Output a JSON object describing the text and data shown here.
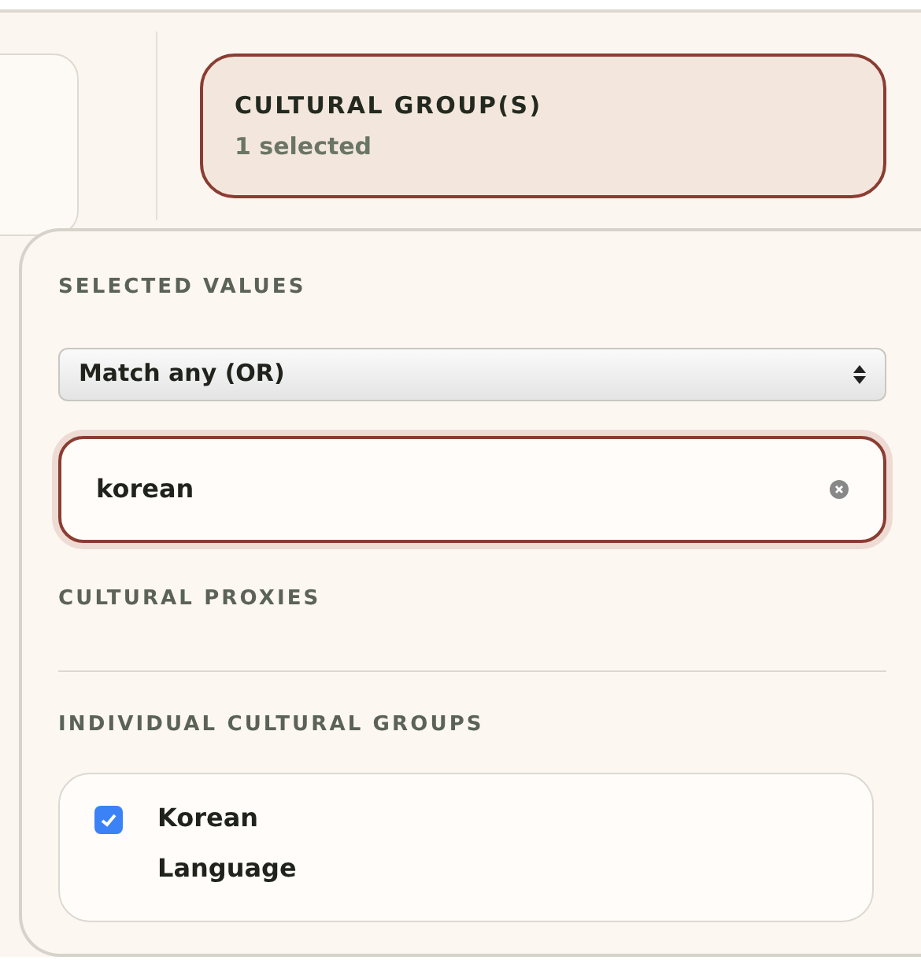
{
  "filter_button": {
    "label": "CULTURAL GROUP(S)",
    "summary": "1 selected",
    "active": true
  },
  "popover": {
    "selected_values_heading": "SELECTED VALUES",
    "match_select": {
      "value": "Match any (OR)"
    },
    "search": {
      "value": "korean"
    },
    "proxies_heading": "CULTURAL PROXIES",
    "groups_heading": "INDIVIDUAL CULTURAL GROUPS",
    "groups": [
      {
        "label": "Korean Language",
        "checked": true
      }
    ]
  }
}
